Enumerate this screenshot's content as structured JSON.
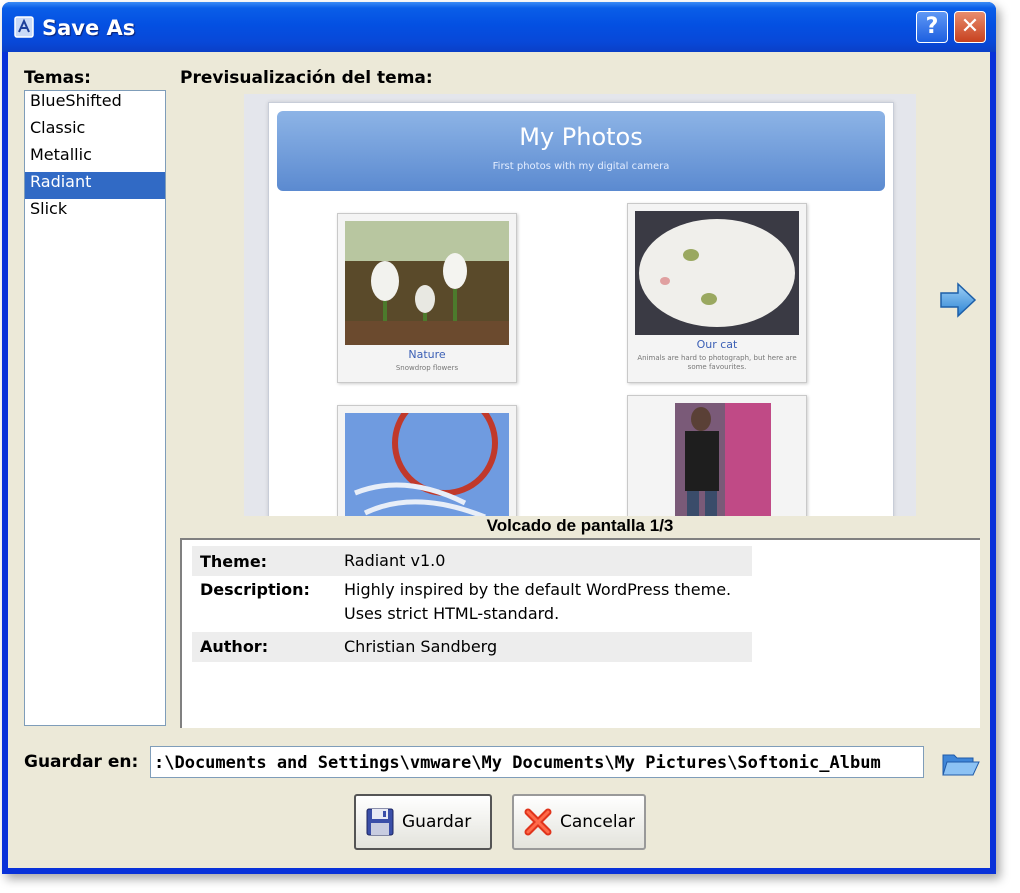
{
  "window": {
    "title": "Save As",
    "help_label": "?",
    "close_label": "✕"
  },
  "themes": {
    "label": "Temas:",
    "items": [
      "BlueShifted",
      "Classic",
      "Metallic",
      "Radiant",
      "Slick"
    ],
    "selected": "Radiant"
  },
  "preview": {
    "label": "Previsualización del tema:",
    "page_title": "My Photos",
    "page_subtitle": "First photos with my digital camera",
    "thumbnails": [
      {
        "caption": "Nature",
        "description": "Snowdrop flowers"
      },
      {
        "caption": "Our cat",
        "description": "Animals are hard to photograph, but here are some favourites."
      },
      {
        "caption": "",
        "description": ""
      },
      {
        "caption": "",
        "description": ""
      }
    ],
    "screenshot_caption": "Volcado de pantalla 1/3"
  },
  "info": {
    "theme_key": "Theme:",
    "theme_value": "Radiant v1.0",
    "description_key": "Description:",
    "description_line1": "Highly inspired by the default WordPress theme.",
    "description_line2": "Uses strict HTML-standard.",
    "author_key": "Author:",
    "author_value": "Christian Sandberg"
  },
  "save_location": {
    "label": "Guardar en:",
    "path": ":\\Documents and Settings\\vmware\\My Documents\\My Pictures\\Softonic_Album"
  },
  "buttons": {
    "save_label": "Guardar",
    "cancel_label": "Cancelar"
  },
  "colors": {
    "titlebar": "#0450e2",
    "selection": "#316ac5",
    "client": "#ece9d8",
    "header_blue": "#5b8ad0"
  },
  "icons": [
    "app-icon",
    "help-icon",
    "close-icon",
    "next-arrow-icon",
    "folder-open-icon",
    "floppy-disk-icon",
    "red-x-icon"
  ]
}
